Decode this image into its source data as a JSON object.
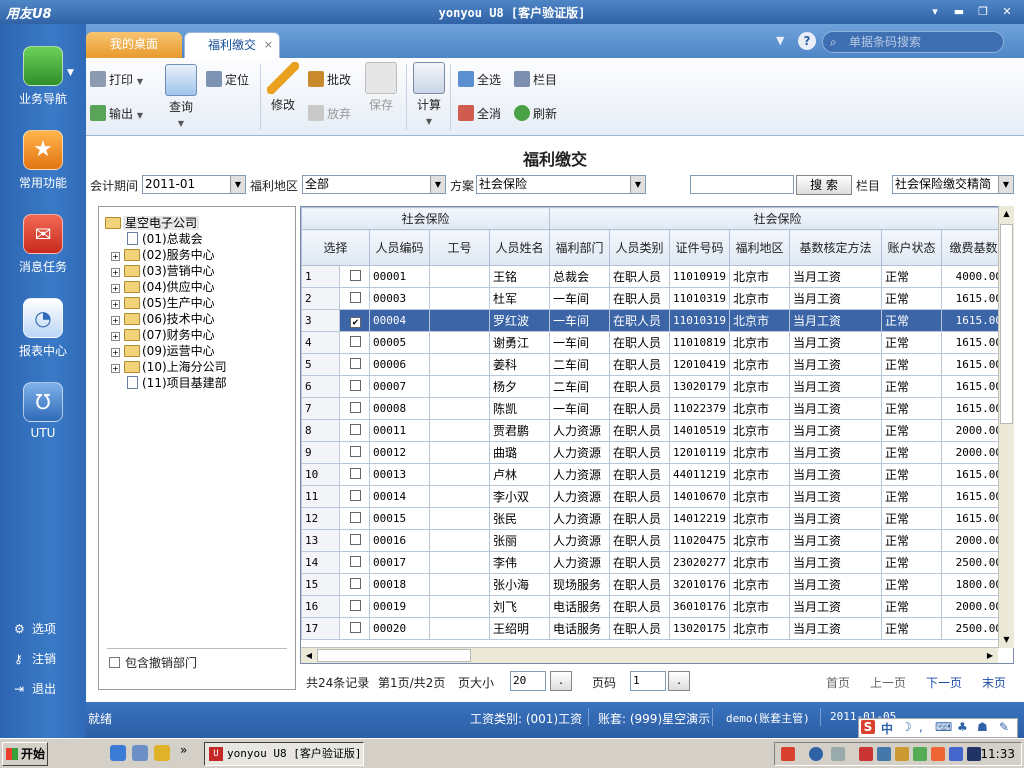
{
  "window": {
    "logo": "用友U8",
    "title": "yonyou U8 [客户验证版]"
  },
  "sidebar": {
    "items": [
      {
        "label": "业务导航",
        "icon": "business-navigation-icon",
        "color": "#3aa335"
      },
      {
        "label": "常用功能",
        "icon": "star-icon",
        "color": "#f08a24"
      },
      {
        "label": "消息任务",
        "icon": "mail-icon",
        "color": "#d83b2b"
      },
      {
        "label": "报表中心",
        "icon": "report-chart-icon",
        "color": "#5a9ee8"
      },
      {
        "label": "UTU",
        "icon": "utu-icon",
        "color": "#4a86cf"
      }
    ],
    "bottom": [
      {
        "label": "选项",
        "icon": "gear-icon"
      },
      {
        "label": "注销",
        "icon": "key-icon"
      },
      {
        "label": "退出",
        "icon": "exit-icon"
      }
    ]
  },
  "tabs": {
    "desktop": "我的桌面",
    "welfare": "福利缴交",
    "close": "×"
  },
  "search": {
    "placeholder": "单据条码搜索",
    "help": "?"
  },
  "toolbar": {
    "print": "打印",
    "export": "输出",
    "query": "查询",
    "locate": "定位",
    "modify": "修改",
    "batch_modify": "批改",
    "discard": "放弃",
    "save": "保存",
    "calculate": "计算",
    "select_all": "全选",
    "columns": "栏目",
    "deselect_all": "全消",
    "refresh": "刷新"
  },
  "page_title": "福利缴交",
  "filters": {
    "period_label": "会计期间",
    "period_value": "2011-01",
    "region_label": "福利地区",
    "region_value": "全部",
    "plan_label": "方案",
    "plan_value": "社会保险",
    "search_button": "搜 索",
    "column_label": "栏目",
    "column_value": "社会保险缴交精简"
  },
  "tree": {
    "root": "星空电子公司",
    "nodes": [
      "(01)总裁会",
      "(02)服务中心",
      "(03)营销中心",
      "(04)供应中心",
      "(05)生产中心",
      "(06)技术中心",
      "(07)财务中心",
      "(09)运营中心",
      "(10)上海分公司",
      "(11)项目基建部"
    ],
    "include_cancelled": "包含撤销部门"
  },
  "grid": {
    "group_left": "社会保险",
    "group_right": "社会保险",
    "headers": [
      "选择",
      "人员编码",
      "工号",
      "人员姓名",
      "福利部门",
      "人员类别",
      "证件号码",
      "福利地区",
      "基数核定方法",
      "账户状态",
      "缴费基数"
    ],
    "rows": [
      {
        "n": "1",
        "code": "00001",
        "name": "王铭",
        "dept": "总裁会",
        "cat": "在职人员",
        "id": "11010919",
        "region": "北京市",
        "method": "当月工资",
        "status": "正常",
        "base": "4000.00"
      },
      {
        "n": "2",
        "code": "00003",
        "name": "杜军",
        "dept": "一车间",
        "cat": "在职人员",
        "id": "11010319",
        "region": "北京市",
        "method": "当月工资",
        "status": "正常",
        "base": "1615.00"
      },
      {
        "n": "3",
        "code": "00004",
        "name": "罗红波",
        "dept": "一车间",
        "cat": "在职人员",
        "id": "11010319",
        "region": "北京市",
        "method": "当月工资",
        "status": "正常",
        "base": "1615.00"
      },
      {
        "n": "4",
        "code": "00005",
        "name": "谢勇江",
        "dept": "一车间",
        "cat": "在职人员",
        "id": "11010819",
        "region": "北京市",
        "method": "当月工资",
        "status": "正常",
        "base": "1615.00"
      },
      {
        "n": "5",
        "code": "00006",
        "name": "姜科",
        "dept": "二车间",
        "cat": "在职人员",
        "id": "12010419",
        "region": "北京市",
        "method": "当月工资",
        "status": "正常",
        "base": "1615.00"
      },
      {
        "n": "6",
        "code": "00007",
        "name": "杨夕",
        "dept": "二车间",
        "cat": "在职人员",
        "id": "13020179",
        "region": "北京市",
        "method": "当月工资",
        "status": "正常",
        "base": "1615.00"
      },
      {
        "n": "7",
        "code": "00008",
        "name": "陈凯",
        "dept": "一车间",
        "cat": "在职人员",
        "id": "11022379",
        "region": "北京市",
        "method": "当月工资",
        "status": "正常",
        "base": "1615.00"
      },
      {
        "n": "8",
        "code": "00011",
        "name": "贾君鹏",
        "dept": "人力资源",
        "cat": "在职人员",
        "id": "14010519",
        "region": "北京市",
        "method": "当月工资",
        "status": "正常",
        "base": "2000.00"
      },
      {
        "n": "9",
        "code": "00012",
        "name": "曲璐",
        "dept": "人力资源",
        "cat": "在职人员",
        "id": "12010119",
        "region": "北京市",
        "method": "当月工资",
        "status": "正常",
        "base": "2000.00"
      },
      {
        "n": "10",
        "code": "00013",
        "name": "卢林",
        "dept": "人力资源",
        "cat": "在职人员",
        "id": "44011219",
        "region": "北京市",
        "method": "当月工资",
        "status": "正常",
        "base": "1615.00"
      },
      {
        "n": "11",
        "code": "00014",
        "name": "李小双",
        "dept": "人力资源",
        "cat": "在职人员",
        "id": "14010670",
        "region": "北京市",
        "method": "当月工资",
        "status": "正常",
        "base": "1615.00"
      },
      {
        "n": "12",
        "code": "00015",
        "name": "张民",
        "dept": "人力资源",
        "cat": "在职人员",
        "id": "14012219",
        "region": "北京市",
        "method": "当月工资",
        "status": "正常",
        "base": "1615.00"
      },
      {
        "n": "13",
        "code": "00016",
        "name": "张丽",
        "dept": "人力资源",
        "cat": "在职人员",
        "id": "11020475",
        "region": "北京市",
        "method": "当月工资",
        "status": "正常",
        "base": "2000.00"
      },
      {
        "n": "14",
        "code": "00017",
        "name": "李伟",
        "dept": "人力资源",
        "cat": "在职人员",
        "id": "23020277",
        "region": "北京市",
        "method": "当月工资",
        "status": "正常",
        "base": "2500.00"
      },
      {
        "n": "15",
        "code": "00018",
        "name": "张小海",
        "dept": "现场服务",
        "cat": "在职人员",
        "id": "32010176",
        "region": "北京市",
        "method": "当月工资",
        "status": "正常",
        "base": "1800.00"
      },
      {
        "n": "16",
        "code": "00019",
        "name": "刘飞",
        "dept": "电话服务",
        "cat": "在职人员",
        "id": "36010176",
        "region": "北京市",
        "method": "当月工资",
        "status": "正常",
        "base": "2000.00"
      },
      {
        "n": "17",
        "code": "00020",
        "name": "王绍明",
        "dept": "电话服务",
        "cat": "在职人员",
        "id": "13020175",
        "region": "北京市",
        "method": "当月工资",
        "status": "正常",
        "base": "2500.00"
      }
    ],
    "selected_row": "3"
  },
  "pager": {
    "total": "共24条记录",
    "page_info": "第1页/共2页",
    "size_label": "页大小",
    "size_value": "20",
    "go": ".",
    "page_label": "页码",
    "page_value": "1",
    "first": "首页",
    "prev": "上一页",
    "next": "下一页",
    "last": "末页"
  },
  "statusbar": {
    "ready": "就绪",
    "salary_type": "工资类别: (001)工资",
    "account": "账套: (999)星空演示",
    "user": "demo(账套主管)",
    "date": "2011-01-05"
  },
  "taskbar": {
    "start": "开始",
    "window": "yonyou U8 [客户验证版]",
    "time": "11:33"
  },
  "ime": {
    "logo": "S",
    "mode": "中"
  }
}
